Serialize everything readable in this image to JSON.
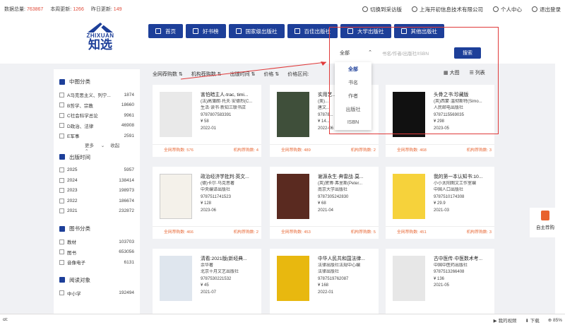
{
  "topbar": {
    "stats": [
      {
        "label": "数据总量:",
        "value": "763867"
      },
      {
        "label": "本周更新:",
        "value": "1266"
      },
      {
        "label": "昨日更新:",
        "value": "149"
      }
    ],
    "switch": "切换到采访版",
    "company": "上海开初信息技术有限公司",
    "personal": "个人中心",
    "logout": "退出登录"
  },
  "logo": {
    "en": "ZHIXUAN",
    "cn": "知选"
  },
  "nav": [
    "首页",
    "好书榜",
    "国家级出版社",
    "百佳出版社",
    "大学出版社",
    "其他出版社"
  ],
  "search": {
    "scope": "全部",
    "placeholder": "书名/作者/出版社/ISBN",
    "button": "搜索",
    "options": [
      "全部",
      "书名",
      "作者",
      "出版社",
      "ISBN"
    ]
  },
  "sortbar": [
    "全网荐购数",
    "机构荐购数",
    "出版时间",
    "价格",
    "价格区间"
  ],
  "view": {
    "large": "大图",
    "list": "列表"
  },
  "sidebar": {
    "sections": [
      {
        "title": "中图分类",
        "items": [
          {
            "label": "A马克思主义、列宁...",
            "count": "1874"
          },
          {
            "label": "B哲学、宗教",
            "count": "18660"
          },
          {
            "label": "C社会科学总论",
            "count": "9961"
          },
          {
            "label": "D政治、法律",
            "count": "46908"
          },
          {
            "label": "E军事",
            "count": "2591"
          }
        ],
        "more": "更多",
        "collapse": "收起"
      },
      {
        "title": "出版时间",
        "items": [
          {
            "label": "2025",
            "count": "5957"
          },
          {
            "label": "2024",
            "count": "138414"
          },
          {
            "label": "2023",
            "count": "198973"
          },
          {
            "label": "2022",
            "count": "186674"
          },
          {
            "label": "2021",
            "count": "232872"
          }
        ]
      },
      {
        "title": "图书分类",
        "items": [
          {
            "label": "教材",
            "count": "103703"
          },
          {
            "label": "图书",
            "count": "653056"
          },
          {
            "label": "音像电子",
            "count": "6131"
          }
        ]
      },
      {
        "title": "阅读对象",
        "items": [
          {
            "label": "中小学",
            "count": "192494"
          }
        ]
      }
    ]
  },
  "books": [
    {
      "title": "害怕暗主人-trac, timi...",
      "author": "(法)高蒲朗·托夫·安德烈(C...",
      "publisher": "生活·读书·新知三联书店",
      "isbn": "9787807583391",
      "price": "¥ 58",
      "date": "2022-01",
      "net": "全网荐购数: 576",
      "org": "机构荐购数: 4",
      "cover": "#e9e9e9"
    },
    {
      "title": "实用艺...",
      "author": "(美)...",
      "publisher": "唐文...",
      "isbn": "97878...",
      "price": "¥ 14...",
      "date": "2022-06",
      "net": "全网荐购数: 489",
      "org": "机构荐购数: 2",
      "cover": "#3f4f3a"
    },
    {
      "title": "头骨之书:珍藏版",
      "author": "(英)西蒙·温彻斯特(Simo...",
      "publisher": "人民邮电出版社",
      "isbn": "9787115569035",
      "price": "¥ 298",
      "date": "2023-05",
      "net": "全网荐购数: 468",
      "org": "机构荐购数: 3",
      "cover": "#111111"
    },
    {
      "title": "政治经济学批判:英文...",
      "author": "(德)卡尔·马克思著",
      "publisher": "中央编译出版社",
      "isbn": "9787511741523",
      "price": "¥ 128",
      "date": "2023-06",
      "net": "全网荐购数: 466",
      "org": "机构荐购数: 2",
      "cover": "#f4f1ea"
    },
    {
      "title": "谢源永生·奔雷战·莫...",
      "author": "(英)黛博·弗里斯(Peter...",
      "publisher": "南京大学出版社",
      "isbn": "9787305242830",
      "price": "¥ 68",
      "date": "2021-04",
      "net": "全网荐购数: 453",
      "org": "机构荐购数: 5",
      "cover": "#5a2a20"
    },
    {
      "title": "我的第一本认知书:10...",
      "author": "小小太阳图文工作室编",
      "publisher": "中国人口出版社",
      "isbn": "9787510174308",
      "price": "¥ 29.9",
      "date": "2021-03",
      "net": "全网荐购数: 451",
      "org": "机构荐购数: 3",
      "cover": "#f6d23b"
    },
    {
      "title": "清看:2021版(新经典...",
      "author": "余华著",
      "publisher": "北京十月文艺出版社",
      "isbn": "9787530221532",
      "price": "¥ 45",
      "date": "2021-07",
      "net": "",
      "org": "",
      "cover": "#dfe6ee"
    },
    {
      "title": "中华人民共和国法律...",
      "author": "法律出版社法规中心编",
      "publisher": "法律出版社",
      "isbn": "9787519762087",
      "price": "¥ 168",
      "date": "2022-01",
      "net": "",
      "org": "",
      "cover": "#e8b80f"
    },
    {
      "title": "古中医传·中医数术考...",
      "author": "",
      "publisher": "中国中医药出版社",
      "isbn": "9787513266408",
      "price": "¥ 136",
      "date": "2021-05",
      "net": "",
      "org": "",
      "cover": "#e7e7e7"
    }
  ],
  "rec": "自主荐购",
  "statusbar": {
    "left": "ot:",
    "video": "我的视频",
    "download": "下载",
    "zoom": "85%"
  }
}
